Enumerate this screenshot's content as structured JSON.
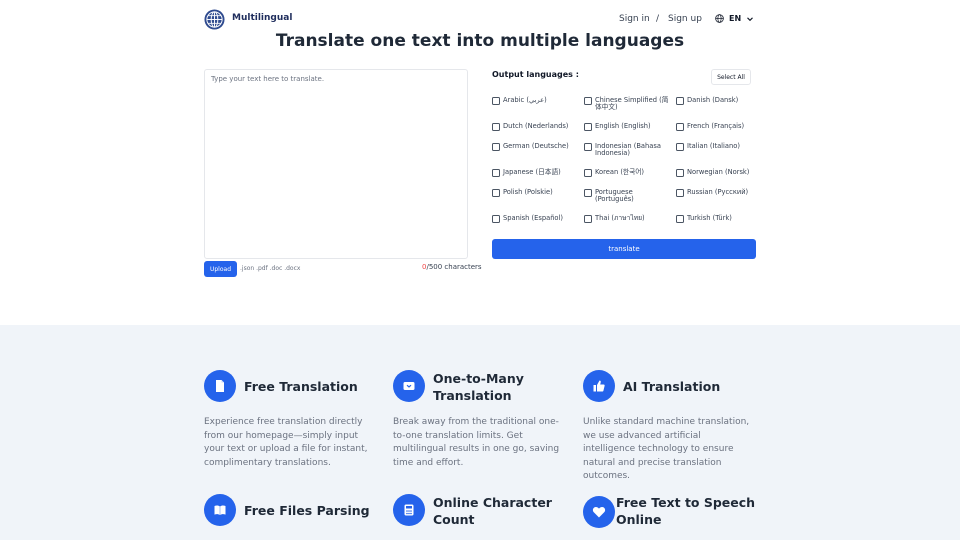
{
  "header": {
    "brand": "Multilingual",
    "sign_in": "Sign in",
    "separator": "/",
    "sign_up": "Sign up",
    "language": "EN"
  },
  "title": "Translate one text into multiple languages",
  "input": {
    "placeholder": "Type your text here to translate.",
    "value": "",
    "upload_label": "Upload",
    "file_types": ".json .pdf .doc .docx",
    "char_current": "0",
    "char_limit": "/500 characters"
  },
  "output": {
    "label": "Output languages :",
    "select_all": "Select All",
    "languages": [
      {
        "label": "Arabic (عربي)"
      },
      {
        "label": "Chinese Simplified (简体中文)"
      },
      {
        "label": "Danish (Dansk)"
      },
      {
        "label": "Dutch (Nederlands)"
      },
      {
        "label": "English (English)"
      },
      {
        "label": "French (Français)"
      },
      {
        "label": "German (Deutsche)"
      },
      {
        "label": "Indonesian (Bahasa Indonesia)"
      },
      {
        "label": "Italian (Italiano)"
      },
      {
        "label": "Japanese (日本語)"
      },
      {
        "label": "Korean (한국어)"
      },
      {
        "label": "Norwegian (Norsk)"
      },
      {
        "label": "Polish (Polskie)"
      },
      {
        "label": "Portuguese (Português)"
      },
      {
        "label": "Russian (Русский)"
      },
      {
        "label": "Spanish (Español)"
      },
      {
        "label": "Thai (ภาษาไทย)"
      },
      {
        "label": "Turkish (Türk)"
      }
    ],
    "translate_label": "translate"
  },
  "features": [
    {
      "title": "Free Translation",
      "icon": "document-icon",
      "description": "Experience free translation directly from our homepage—simply input your text or upload a file for instant, complimentary translations."
    },
    {
      "title": "One-to-Many Translation",
      "icon": "share-icon",
      "description": "Break away from the traditional one-to-one translation limits. Get multilingual results in one go, saving time and effort."
    },
    {
      "title": "AI Translation",
      "icon": "thumbs-up-icon",
      "description": "Unlike standard machine translation, we use advanced artificial intelligence technology to ensure natural and precise translation outcomes."
    },
    {
      "title": "Free Files Parsing",
      "icon": "book-icon"
    },
    {
      "title": "Online Character Count",
      "icon": "calculator-icon"
    },
    {
      "title": "Free Text to Speech Online",
      "icon": "heart-icon"
    }
  ],
  "colors": {
    "primary": "#2563eb",
    "features_bg": "#f0f4f9",
    "count_red": "#ef4444"
  }
}
